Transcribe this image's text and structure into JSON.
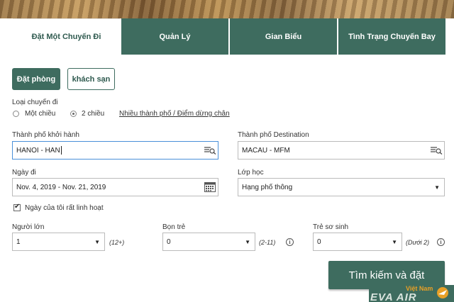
{
  "tabs": [
    {
      "label": "Đặt Một Chuyến Đi"
    },
    {
      "label": "Quản Lý"
    },
    {
      "label": "Gian Biểu"
    },
    {
      "label": "Tình Trạng Chuyến Bay"
    }
  ],
  "booking_type": {
    "flight_hotel": "Đặt phòng",
    "hotel": "khách sạn"
  },
  "trip_type": {
    "label": "Loại chuyến đi",
    "options": [
      {
        "label": "Một chiều",
        "selected": false
      },
      {
        "label": "2 chiều",
        "selected": true
      }
    ],
    "multi_city_link": "Nhiều thành phố / Điểm dừng chân"
  },
  "origin": {
    "label": "Thành phố khởi hành",
    "value": "HANOI - HAN"
  },
  "destination": {
    "label": "Thành phố Destination",
    "value": "MACAU - MFM"
  },
  "dates": {
    "label": "Ngày đi",
    "value": "Nov. 4, 2019 - Nov. 21, 2019"
  },
  "cabin": {
    "label": "Lớp học",
    "value": "Hạng phổ thông"
  },
  "flexible": {
    "label": "Ngày của tôi rất linh hoạt",
    "checked": true
  },
  "passengers": {
    "adults": {
      "label": "Người lớn",
      "value": "1",
      "hint": "(12+)"
    },
    "children": {
      "label": "Bọn trẻ",
      "value": "0",
      "hint": "(2-11)"
    },
    "infants": {
      "label": "Trẻ sơ sinh",
      "value": "0",
      "hint": "(Dưới 2)"
    }
  },
  "search_button": "Tìm kiếm và đặt",
  "logo": {
    "country": "Việt Nam",
    "name": "EVA AIR"
  },
  "colors": {
    "primary": "#3e6c5f",
    "accent": "#e8a026"
  }
}
